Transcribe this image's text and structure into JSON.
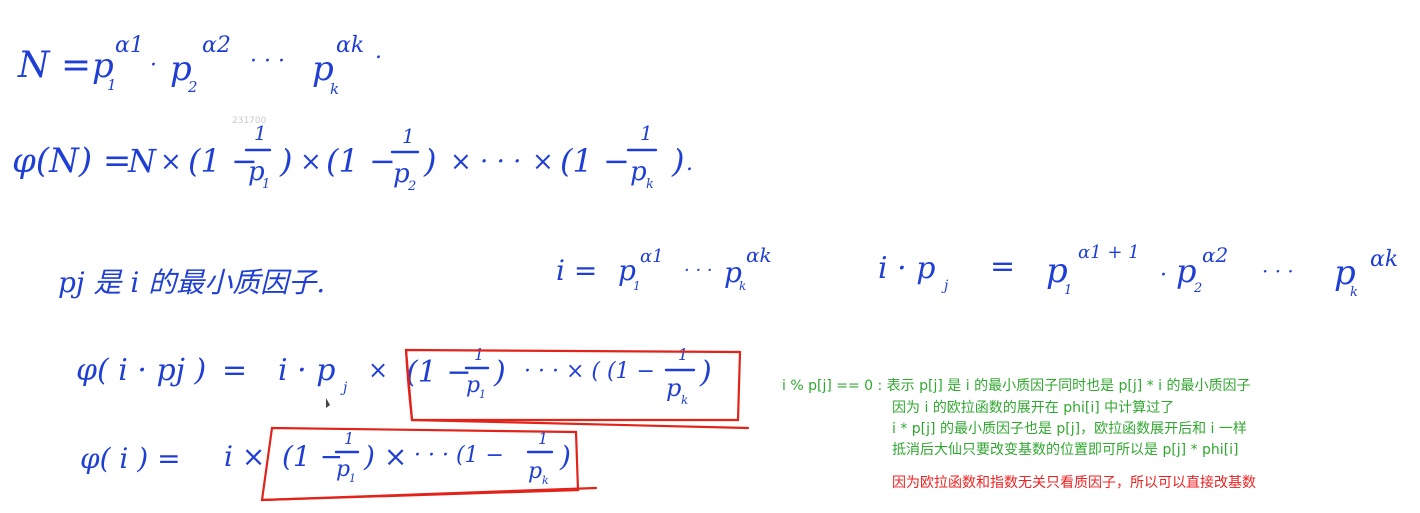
{
  "colors": {
    "ink": "#1f3fd4",
    "box": "#e2231a",
    "note_green": "#30a830",
    "note_red": "#ee2222"
  },
  "watermark": "231700",
  "eq1": {
    "lhs": "N =",
    "p1": "p",
    "sub1": "1",
    "exp1": "α1",
    "dot": "·",
    "p2": "p",
    "sub2": "2",
    "exp2": "α2",
    "dots": "· · ·",
    "pk": "p",
    "subk": "k",
    "expk": "αk",
    "end": "."
  },
  "eq2": {
    "lhs": "φ(N) =",
    "n": "N",
    "times": "×",
    "open": "(1 −",
    "close": ")",
    "one": "1",
    "p": "p",
    "s1": "1",
    "s2": "2",
    "sk": "k",
    "mid": "× · · ·",
    "end": "."
  },
  "eq3": {
    "pj_text": "pj 是 i 的最小质因子.",
    "i_lhs": "i =",
    "i_p1": "p",
    "i_s1": "1",
    "i_e1": "α1",
    "i_dots": "· · ·",
    "i_pk": "p",
    "i_sk": "k",
    "i_ek": "αk",
    "ipj_lhs": "i · p",
    "ipj_sub": "j",
    "eq": "=",
    "r_p1": "p",
    "r_s1": "1",
    "r_e1": "α1 + 1",
    "r_dot": "·",
    "r_p2": "p",
    "r_s2": "2",
    "r_e2": "α2",
    "r_dots": "· · ·",
    "r_pk": "p",
    "r_sk": "k",
    "r_ek": "αk"
  },
  "eq4": {
    "lhs": "φ( i · pj )",
    "eq": "=",
    "i": "i · p",
    "isub": "j",
    "times": "×",
    "open": "(1 −",
    "one": "1",
    "p": "p",
    "s1": "1",
    "close": ")",
    "mid": "· · ·  × ( (1 −",
    "sk": "k",
    "end": ")"
  },
  "eq5": {
    "lhs": "φ( i ) =",
    "i": "i ×",
    "open": "(1 −",
    "one": "1",
    "p": "p",
    "s1": "1",
    "close": ") ×",
    "mid": "· · ·   (1 −",
    "sk": "k",
    "end": ")"
  },
  "notes": {
    "line1": "i % p[j] == 0 : 表示 p[j] 是 i  的最小质因子同时也是 p[j] * i 的最小质因子",
    "line2": "因为 i 的欧拉函数的展开在 phi[i] 中计算过了",
    "line3": "i * p[j] 的最小质因子也是 p[j]，欧拉函数展开后和 i 一样",
    "line4": "抵消后大仙只要改变基数的位置即可所以是 p[j] * phi[i]",
    "conclusion": "因为欧拉函数和指数无关只看质因子，所以可以直接改基数"
  }
}
